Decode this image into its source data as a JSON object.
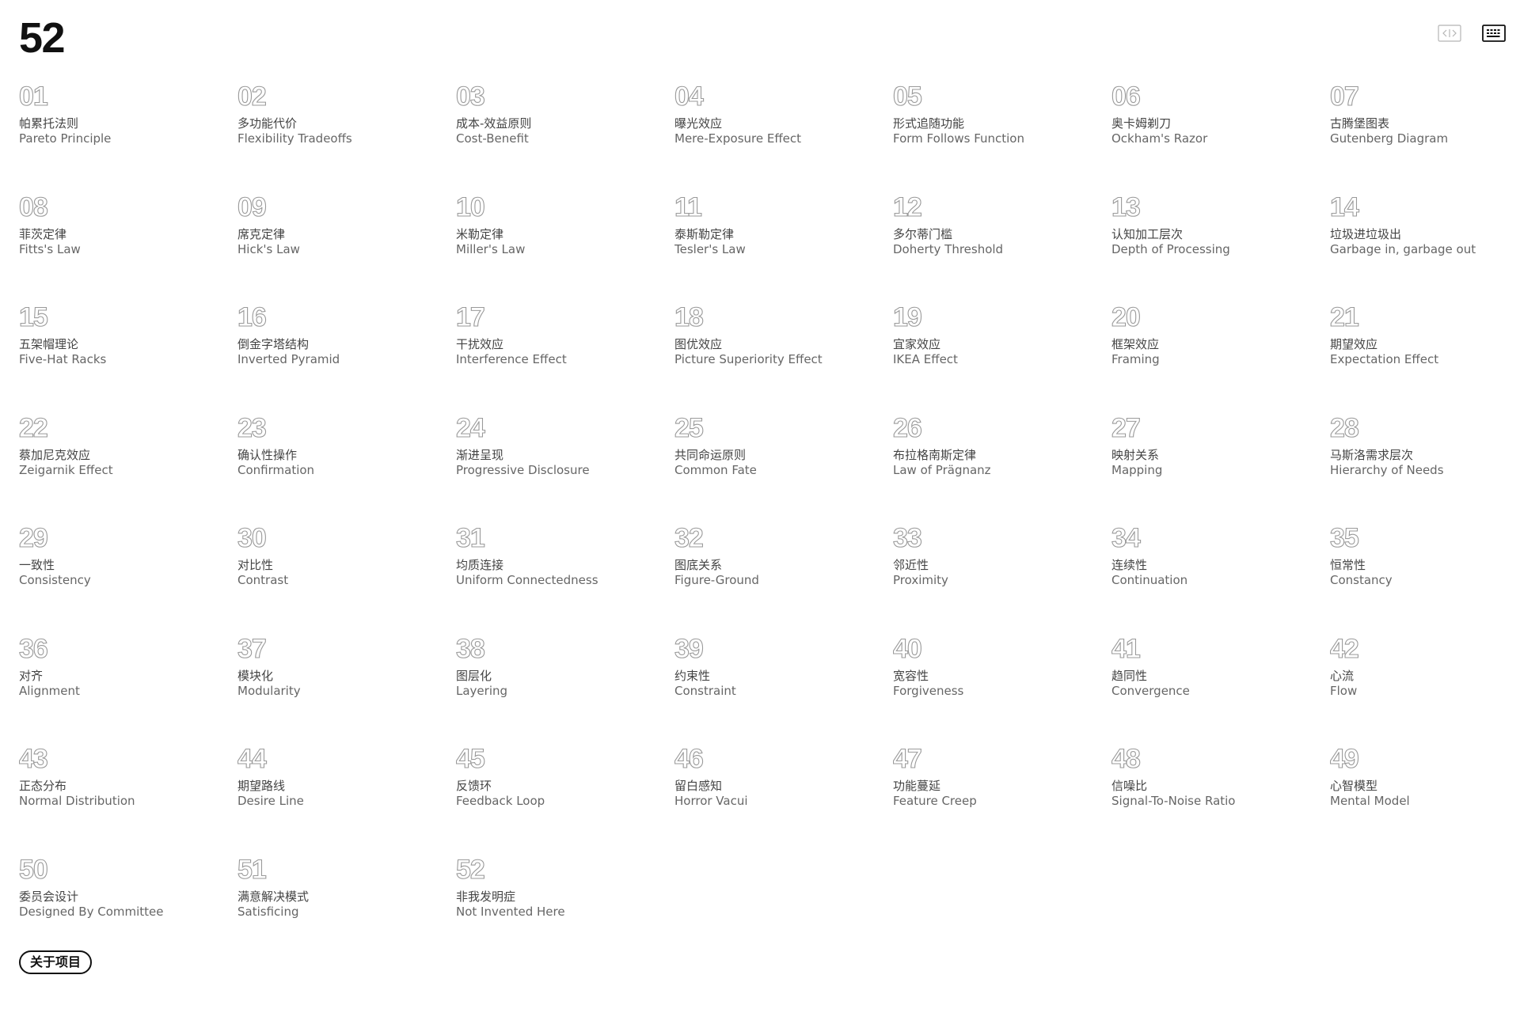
{
  "header": {
    "title": "52",
    "code_view_icon": "code-brackets-icon",
    "grid_view_icon": "keyboard-grid-icon"
  },
  "principles": [
    {
      "num": "01",
      "cn": "帕累托法则",
      "en": "Pareto Principle"
    },
    {
      "num": "02",
      "cn": "多功能代价",
      "en": "Flexibility Tradeoffs"
    },
    {
      "num": "03",
      "cn": "成本-效益原则",
      "en": "Cost-Benefit"
    },
    {
      "num": "04",
      "cn": "曝光效应",
      "en": "Mere-Exposure Effect"
    },
    {
      "num": "05",
      "cn": "形式追随功能",
      "en": "Form Follows Function"
    },
    {
      "num": "06",
      "cn": "奥卡姆剃刀",
      "en": "Ockham's Razor"
    },
    {
      "num": "07",
      "cn": "古腾堡图表",
      "en": "Gutenberg Diagram"
    },
    {
      "num": "08",
      "cn": "菲茨定律",
      "en": "Fitts's Law"
    },
    {
      "num": "09",
      "cn": "席克定律",
      "en": "Hick's Law"
    },
    {
      "num": "10",
      "cn": "米勒定律",
      "en": "Miller's Law"
    },
    {
      "num": "11",
      "cn": "泰斯勒定律",
      "en": "Tesler's Law"
    },
    {
      "num": "12",
      "cn": "多尔蒂门槛",
      "en": "Doherty Threshold"
    },
    {
      "num": "13",
      "cn": "认知加工层次",
      "en": "Depth of Processing"
    },
    {
      "num": "14",
      "cn": "垃圾进垃圾出",
      "en": "Garbage in, garbage out"
    },
    {
      "num": "15",
      "cn": "五架帽理论",
      "en": "Five-Hat Racks"
    },
    {
      "num": "16",
      "cn": "倒金字塔结构",
      "en": "Inverted Pyramid"
    },
    {
      "num": "17",
      "cn": "干扰效应",
      "en": "Interference Effect"
    },
    {
      "num": "18",
      "cn": "图优效应",
      "en": "Picture Superiority Effect"
    },
    {
      "num": "19",
      "cn": "宜家效应",
      "en": "IKEA Effect"
    },
    {
      "num": "20",
      "cn": "框架效应",
      "en": "Framing"
    },
    {
      "num": "21",
      "cn": "期望效应",
      "en": "Expectation Effect"
    },
    {
      "num": "22",
      "cn": "蔡加尼克效应",
      "en": "Zeigarnik Effect"
    },
    {
      "num": "23",
      "cn": "确认性操作",
      "en": "Confirmation"
    },
    {
      "num": "24",
      "cn": "渐进呈现",
      "en": "Progressive Disclosure"
    },
    {
      "num": "25",
      "cn": "共同命运原则",
      "en": "Common Fate"
    },
    {
      "num": "26",
      "cn": "布拉格南斯定律",
      "en": "Law of Prägnanz"
    },
    {
      "num": "27",
      "cn": "映射关系",
      "en": "Mapping"
    },
    {
      "num": "28",
      "cn": "马斯洛需求层次",
      "en": "Hierarchy of Needs"
    },
    {
      "num": "29",
      "cn": "一致性",
      "en": "Consistency"
    },
    {
      "num": "30",
      "cn": "对比性",
      "en": "Contrast"
    },
    {
      "num": "31",
      "cn": "均质连接",
      "en": "Uniform Connectedness"
    },
    {
      "num": "32",
      "cn": "图底关系",
      "en": "Figure-Ground"
    },
    {
      "num": "33",
      "cn": "邻近性",
      "en": "Proximity"
    },
    {
      "num": "34",
      "cn": "连续性",
      "en": "Continuation"
    },
    {
      "num": "35",
      "cn": "恒常性",
      "en": "Constancy"
    },
    {
      "num": "36",
      "cn": "对齐",
      "en": "Alignment"
    },
    {
      "num": "37",
      "cn": "模块化",
      "en": "Modularity"
    },
    {
      "num": "38",
      "cn": "图层化",
      "en": "Layering"
    },
    {
      "num": "39",
      "cn": "约束性",
      "en": "Constraint"
    },
    {
      "num": "40",
      "cn": "宽容性",
      "en": "Forgiveness"
    },
    {
      "num": "41",
      "cn": "趋同性",
      "en": "Convergence"
    },
    {
      "num": "42",
      "cn": "心流",
      "en": "Flow"
    },
    {
      "num": "43",
      "cn": "正态分布",
      "en": "Normal Distribution"
    },
    {
      "num": "44",
      "cn": "期望路线",
      "en": "Desire Line"
    },
    {
      "num": "45",
      "cn": "反馈环",
      "en": "Feedback Loop"
    },
    {
      "num": "46",
      "cn": "留白感知",
      "en": "Horror Vacui"
    },
    {
      "num": "47",
      "cn": "功能蔓延",
      "en": "Feature Creep"
    },
    {
      "num": "48",
      "cn": "信噪比",
      "en": "Signal-To-Noise Ratio"
    },
    {
      "num": "49",
      "cn": "心智模型",
      "en": "Mental Model"
    },
    {
      "num": "50",
      "cn": "委员会设计",
      "en": "Designed By Committee"
    },
    {
      "num": "51",
      "cn": "满意解决模式",
      "en": "Satisficing"
    },
    {
      "num": "52",
      "cn": "非我发明症",
      "en": "Not Invented Here"
    }
  ],
  "footer": {
    "about_label": "关于项目"
  }
}
